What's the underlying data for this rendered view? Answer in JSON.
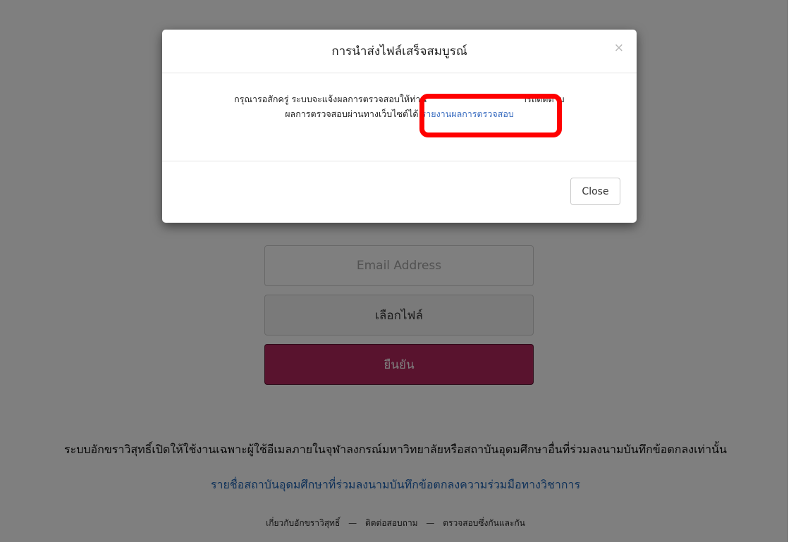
{
  "form": {
    "email_placeholder": "Email Address",
    "file_button": "เลือกไฟล์",
    "submit_button": "ยืนยัน"
  },
  "notice": {
    "text": "ระบบอักขราวิสุทธิ์เปิดให้ใช้งานเฉพาะผู้ใช้อีเมลภายในจุฬาลงกรณ์มหาวิทยาลัยหรือสถาบันอุดมศึกษาอื่นที่ร่วมลงนามบันทึกข้อตกลงเท่านั้น",
    "link": "รายชื่อสถาบันอุดมศึกษาที่ร่วมลงนามบันทึกข้อตกลงความร่วมมือทางวิชาการ"
  },
  "footer": {
    "about": "เกี่ยวกับอักขราวิสุทธิ์",
    "contact": "ติดต่อสอบถาม",
    "plagiarism_check": "ตรวจสอบซึ่งกันและกัน",
    "separator": "—"
  },
  "modal": {
    "title": "การนำส่งไฟล์เสร็จสมบูรณ์",
    "close_symbol": "×",
    "body_line1": "กรุณารอสักครู่ ระบบจะแจ้งผลการตรวจสอบให้ท่าน",
    "body_line1_tail": "ารถติดตาม",
    "body_line2": "ผลการตรวจสอบผ่านทางเว็บไซต์ได้",
    "report_link": "รายงานผลการตรวจสอบ",
    "close_button": "Close"
  },
  "colors": {
    "highlight": "#ff0000",
    "submit_bg": "#b3265c",
    "link": "#1f63b3"
  }
}
